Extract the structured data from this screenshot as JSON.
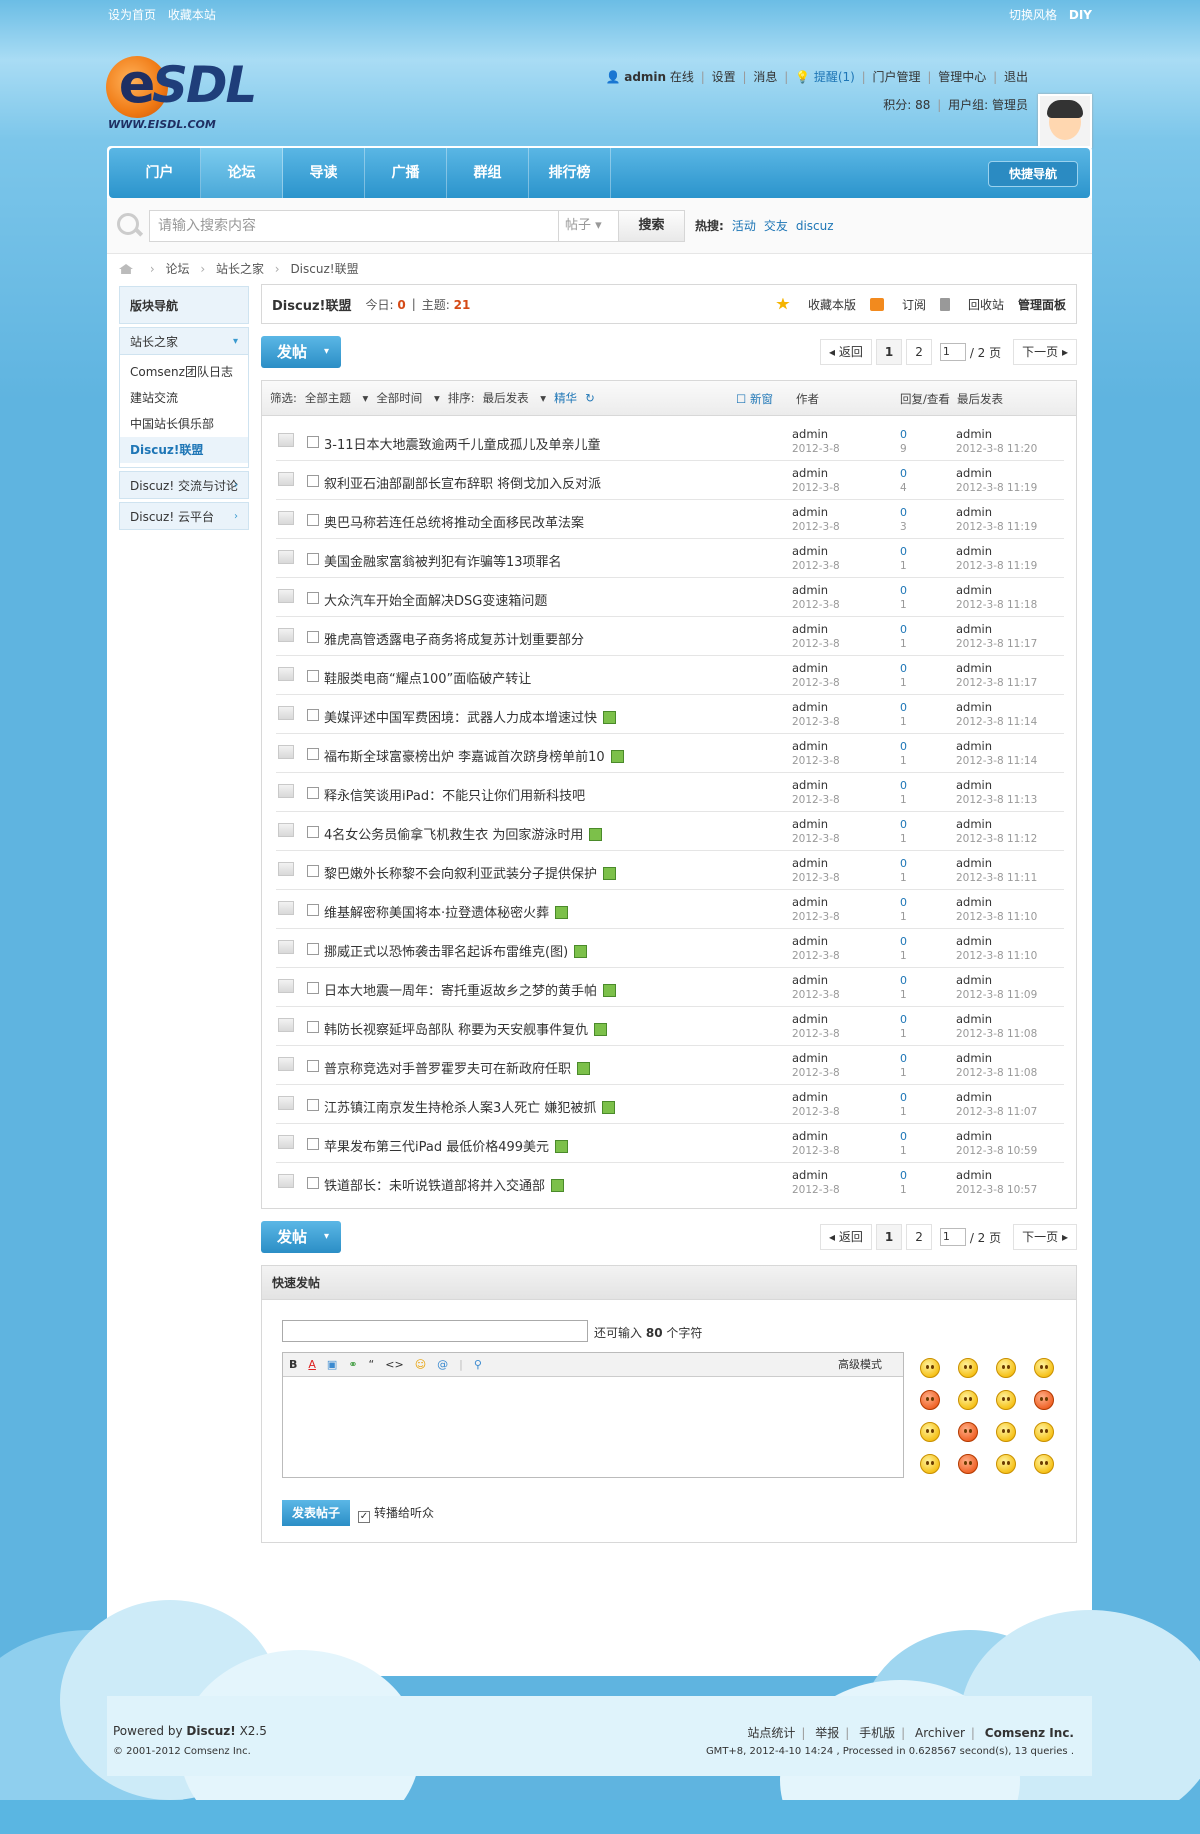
{
  "topbar": {
    "left": [
      "设为首页",
      "收藏本站"
    ],
    "right": [
      "切换风格",
      "DIY"
    ]
  },
  "logo": {
    "mark": "e",
    "text": "SDL",
    "url": "WWW.EISDL.COM"
  },
  "user": {
    "name": "admin",
    "status": "在线",
    "settings": "设置",
    "messages": "消息",
    "alert": "提醒(1)",
    "portal": "门户管理",
    "admin": "管理中心",
    "logout": "退出",
    "points": "积分: 88",
    "group": "用户组: 管理员"
  },
  "nav": {
    "items": [
      "门户",
      "论坛",
      "导读",
      "广播",
      "群组",
      "排行榜"
    ],
    "active": 1,
    "quick": "快捷导航"
  },
  "search": {
    "placeholder": "请输入搜索内容",
    "category": "帖子",
    "button": "搜索",
    "hot_label": "热搜:",
    "hot": [
      "活动",
      "交友",
      "discuz"
    ]
  },
  "breadcrumb": [
    "论坛",
    "站长之家",
    "Discuz!联盟"
  ],
  "sidebar": {
    "title": "版块导航",
    "group1": "站长之家",
    "sub": [
      "Comsenz团队日志",
      "建站交流",
      "中国站长俱乐部",
      "Discuz!联盟"
    ],
    "group2": "Discuz! 交流与讨论",
    "group3": "Discuz! 云平台"
  },
  "forum": {
    "name": "Discuz!联盟",
    "today_label": "今日:",
    "today": "0",
    "threads_label": "主题:",
    "threads": "21",
    "fav": "收藏本版",
    "rss": "订阅",
    "recycle": "回收站",
    "panel": "管理面板"
  },
  "toolbar": {
    "post": "发帖",
    "back": "返回",
    "page1": "1",
    "page2": "2",
    "page_input": "1",
    "total": "/ 2 页",
    "next": "下一页"
  },
  "filter": {
    "label": "筛选:",
    "all": "全部主题",
    "time": "全部时间",
    "sort_label": "排序:",
    "sort": "最后发表",
    "digest": "精华",
    "refresh": "↻",
    "newwin": "新窗",
    "author": "作者",
    "replies": "回复/查看",
    "last": "最后发表"
  },
  "threads": [
    {
      "title": "3-11日本大地震致逾两千儿童成孤儿及单亲儿童",
      "img": false,
      "author": "admin",
      "date": "2012-3-8",
      "replies": "0",
      "views": "9",
      "last_user": "admin",
      "last_time": "2012-3-8 11:20"
    },
    {
      "title": "叙利亚石油部副部长宣布辞职 将倒戈加入反对派",
      "img": false,
      "author": "admin",
      "date": "2012-3-8",
      "replies": "0",
      "views": "4",
      "last_user": "admin",
      "last_time": "2012-3-8 11:19"
    },
    {
      "title": "奥巴马称若连任总统将推动全面移民改革法案",
      "img": false,
      "author": "admin",
      "date": "2012-3-8",
      "replies": "0",
      "views": "3",
      "last_user": "admin",
      "last_time": "2012-3-8 11:19"
    },
    {
      "title": "美国金融家富翁被判犯有诈骗等13项罪名",
      "img": false,
      "author": "admin",
      "date": "2012-3-8",
      "replies": "0",
      "views": "1",
      "last_user": "admin",
      "last_time": "2012-3-8 11:19"
    },
    {
      "title": "大众汽车开始全面解决DSG变速箱问题",
      "img": false,
      "author": "admin",
      "date": "2012-3-8",
      "replies": "0",
      "views": "1",
      "last_user": "admin",
      "last_time": "2012-3-8 11:18"
    },
    {
      "title": "雅虎高管透露电子商务将成复苏计划重要部分",
      "img": false,
      "author": "admin",
      "date": "2012-3-8",
      "replies": "0",
      "views": "1",
      "last_user": "admin",
      "last_time": "2012-3-8 11:17"
    },
    {
      "title": "鞋服类电商“耀点100”面临破产转让",
      "img": false,
      "author": "admin",
      "date": "2012-3-8",
      "replies": "0",
      "views": "1",
      "last_user": "admin",
      "last_time": "2012-3-8 11:17"
    },
    {
      "title": "美媒评述中国军费困境：武器人力成本增速过快",
      "img": true,
      "author": "admin",
      "date": "2012-3-8",
      "replies": "0",
      "views": "1",
      "last_user": "admin",
      "last_time": "2012-3-8 11:14"
    },
    {
      "title": "福布斯全球富豪榜出炉 李嘉诚首次跻身榜单前10",
      "img": true,
      "author": "admin",
      "date": "2012-3-8",
      "replies": "0",
      "views": "1",
      "last_user": "admin",
      "last_time": "2012-3-8 11:14"
    },
    {
      "title": "释永信笑谈用iPad：不能只让你们用新科技吧",
      "img": false,
      "author": "admin",
      "date": "2012-3-8",
      "replies": "0",
      "views": "1",
      "last_user": "admin",
      "last_time": "2012-3-8 11:13"
    },
    {
      "title": "4名女公务员偷拿飞机救生衣 为回家游泳时用",
      "img": true,
      "author": "admin",
      "date": "2012-3-8",
      "replies": "0",
      "views": "1",
      "last_user": "admin",
      "last_time": "2012-3-8 11:12"
    },
    {
      "title": "黎巴嫩外长称黎不会向叙利亚武装分子提供保护",
      "img": true,
      "author": "admin",
      "date": "2012-3-8",
      "replies": "0",
      "views": "1",
      "last_user": "admin",
      "last_time": "2012-3-8 11:11"
    },
    {
      "title": "维基解密称美国将本·拉登遗体秘密火葬",
      "img": true,
      "author": "admin",
      "date": "2012-3-8",
      "replies": "0",
      "views": "1",
      "last_user": "admin",
      "last_time": "2012-3-8 11:10"
    },
    {
      "title": "挪威正式以恐怖袭击罪名起诉布雷维克(图)",
      "img": true,
      "author": "admin",
      "date": "2012-3-8",
      "replies": "0",
      "views": "1",
      "last_user": "admin",
      "last_time": "2012-3-8 11:10"
    },
    {
      "title": "日本大地震一周年：寄托重返故乡之梦的黄手帕",
      "img": true,
      "author": "admin",
      "date": "2012-3-8",
      "replies": "0",
      "views": "1",
      "last_user": "admin",
      "last_time": "2012-3-8 11:09"
    },
    {
      "title": "韩防长视察延坪岛部队 称要为天安舰事件复仇",
      "img": true,
      "author": "admin",
      "date": "2012-3-8",
      "replies": "0",
      "views": "1",
      "last_user": "admin",
      "last_time": "2012-3-8 11:08"
    },
    {
      "title": "普京称竞选对手普罗霍罗夫可在新政府任职",
      "img": true,
      "author": "admin",
      "date": "2012-3-8",
      "replies": "0",
      "views": "1",
      "last_user": "admin",
      "last_time": "2012-3-8 11:08"
    },
    {
      "title": "江苏镇江南京发生持枪杀人案3人死亡 嫌犯被抓",
      "img": true,
      "author": "admin",
      "date": "2012-3-8",
      "replies": "0",
      "views": "1",
      "last_user": "admin",
      "last_time": "2012-3-8 11:07"
    },
    {
      "title": "苹果发布第三代iPad 最低价格499美元",
      "img": true,
      "author": "admin",
      "date": "2012-3-8",
      "replies": "0",
      "views": "1",
      "last_user": "admin",
      "last_time": "2012-3-8 10:59"
    },
    {
      "title": "铁道部长：未听说铁道部将并入交通部",
      "img": true,
      "author": "admin",
      "date": "2012-3-8",
      "replies": "0",
      "views": "1",
      "last_user": "admin",
      "last_time": "2012-3-8 10:57"
    }
  ],
  "quickpost": {
    "title": "快速发帖",
    "remain_pre": "还可输入",
    "remain_num": "80",
    "remain_post": "个字符",
    "tools": [
      "B",
      "A",
      "▣",
      "⚭",
      "“",
      "<>",
      "☺",
      "@",
      "|",
      "⚲"
    ],
    "advanced": "高级模式",
    "submit": "发表帖子",
    "forward": "转播给听众",
    "forward_check": "✓"
  },
  "footer": {
    "powered_pre": "Powered by",
    "powered_brand": "Discuz!",
    "version": "X2.5",
    "copyright": "© 2001-2012 Comsenz Inc.",
    "links": [
      "站点统计",
      "举报",
      "手机版",
      "Archiver"
    ],
    "company": "Comsenz Inc.",
    "gmt": "GMT+8, 2012-4-10 14:24 , Processed in 0.628567 second(s), 13 queries ."
  }
}
